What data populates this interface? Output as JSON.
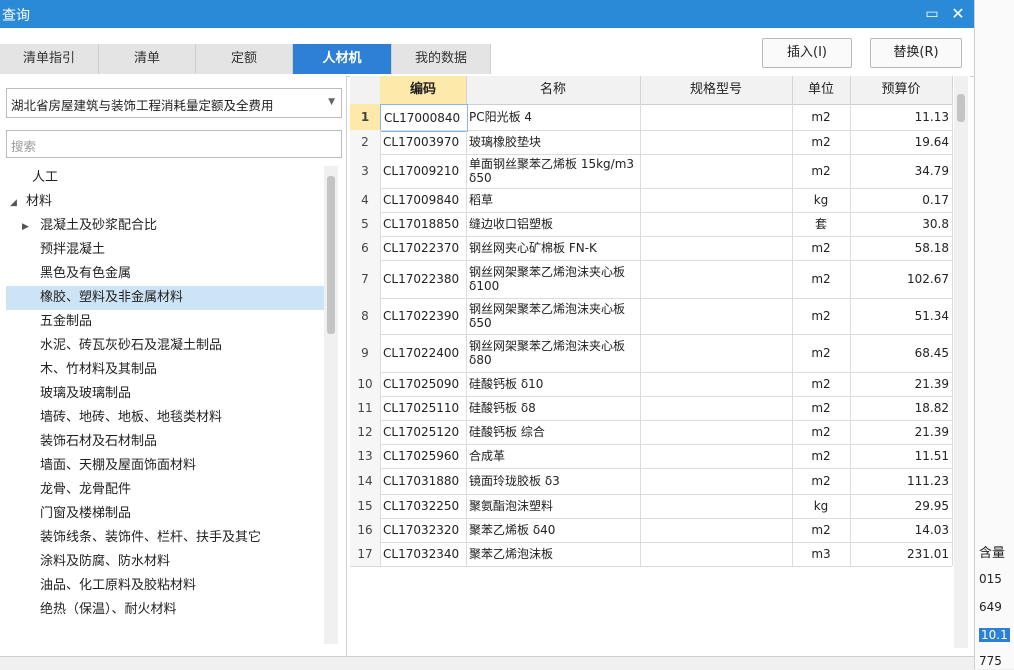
{
  "window": {
    "title": "查询"
  },
  "tabs": [
    {
      "label": "清单指引",
      "active": false
    },
    {
      "label": "清单",
      "active": false
    },
    {
      "label": "定额",
      "active": false
    },
    {
      "label": "人材机",
      "active": true
    },
    {
      "label": "我的数据",
      "active": false
    }
  ],
  "buttons": {
    "insert": "插入(I)",
    "replace": "替换(R)"
  },
  "left": {
    "library": "湖北省房屋建筑与装饰工程消耗量定额及全费用",
    "search_placeholder": "搜索",
    "tree": [
      {
        "label": "人工",
        "level": 0,
        "toggle": "",
        "selected": false
      },
      {
        "label": "材料",
        "level": 0,
        "toggle": "◢",
        "selected": false
      },
      {
        "label": "混凝土及砂浆配合比",
        "level": 1,
        "toggle": "▶",
        "selected": false
      },
      {
        "label": "预拌混凝土",
        "level": 1,
        "toggle": "",
        "selected": false
      },
      {
        "label": "黑色及有色金属",
        "level": 1,
        "toggle": "",
        "selected": false
      },
      {
        "label": "橡胶、塑料及非金属材料",
        "level": 1,
        "toggle": "",
        "selected": true
      },
      {
        "label": "五金制品",
        "level": 1,
        "toggle": "",
        "selected": false
      },
      {
        "label": "水泥、砖瓦灰砂石及混凝土制品",
        "level": 1,
        "toggle": "",
        "selected": false
      },
      {
        "label": "木、竹材料及其制品",
        "level": 1,
        "toggle": "",
        "selected": false
      },
      {
        "label": "玻璃及玻璃制品",
        "level": 1,
        "toggle": "",
        "selected": false
      },
      {
        "label": "墙砖、地砖、地板、地毯类材料",
        "level": 1,
        "toggle": "",
        "selected": false
      },
      {
        "label": "装饰石材及石材制品",
        "level": 1,
        "toggle": "",
        "selected": false
      },
      {
        "label": "墙面、天棚及屋面饰面材料",
        "level": 1,
        "toggle": "",
        "selected": false
      },
      {
        "label": "龙骨、龙骨配件",
        "level": 1,
        "toggle": "",
        "selected": false
      },
      {
        "label": "门窗及楼梯制品",
        "level": 1,
        "toggle": "",
        "selected": false
      },
      {
        "label": "装饰线条、装饰件、栏杆、扶手及其它",
        "level": 1,
        "toggle": "",
        "selected": false
      },
      {
        "label": "涂料及防腐、防水材料",
        "level": 1,
        "toggle": "",
        "selected": false
      },
      {
        "label": "油品、化工原料及胶粘材料",
        "level": 1,
        "toggle": "",
        "selected": false
      },
      {
        "label": "绝热（保温）、耐火材料",
        "level": 1,
        "toggle": "",
        "selected": false
      }
    ]
  },
  "table": {
    "columns": [
      "",
      "编码",
      "名称",
      "规格型号",
      "单位",
      "预算价"
    ],
    "rows": [
      {
        "n": "1",
        "code": "CL17000840",
        "name": "PC阳光板 4",
        "spec": "",
        "unit": "m2",
        "price": "11.13"
      },
      {
        "n": "2",
        "code": "CL17003970",
        "name": "玻璃橡胶垫块",
        "spec": "",
        "unit": "m2",
        "price": "19.64"
      },
      {
        "n": "3",
        "code": "CL17009210",
        "name": "单面钢丝聚苯乙烯板 15kg/m3 δ50",
        "spec": "",
        "unit": "m2",
        "price": "34.79"
      },
      {
        "n": "4",
        "code": "CL17009840",
        "name": "稻草",
        "spec": "",
        "unit": "kg",
        "price": "0.17"
      },
      {
        "n": "5",
        "code": "CL17018850",
        "name": "缝边收口铝塑板",
        "spec": "",
        "unit": "套",
        "price": "30.8"
      },
      {
        "n": "6",
        "code": "CL17022370",
        "name": "钢丝网夹心矿棉板 FN-K",
        "spec": "",
        "unit": "m2",
        "price": "58.18"
      },
      {
        "n": "7",
        "code": "CL17022380",
        "name": "钢丝网架聚苯乙烯泡沫夹心板 δ100",
        "spec": "",
        "unit": "m2",
        "price": "102.67"
      },
      {
        "n": "8",
        "code": "CL17022390",
        "name": "钢丝网架聚苯乙烯泡沫夹心板 δ50",
        "spec": "",
        "unit": "m2",
        "price": "51.34"
      },
      {
        "n": "9",
        "code": "CL17022400",
        "name": "钢丝网架聚苯乙烯泡沫夹心板 δ80",
        "spec": "",
        "unit": "m2",
        "price": "68.45"
      },
      {
        "n": "10",
        "code": "CL17025090",
        "name": "硅酸钙板 δ10",
        "spec": "",
        "unit": "m2",
        "price": "21.39"
      },
      {
        "n": "11",
        "code": "CL17025110",
        "name": "硅酸钙板 δ8",
        "spec": "",
        "unit": "m2",
        "price": "18.82"
      },
      {
        "n": "12",
        "code": "CL17025120",
        "name": "硅酸钙板 综合",
        "spec": "",
        "unit": "m2",
        "price": "21.39"
      },
      {
        "n": "13",
        "code": "CL17025960",
        "name": "合成革",
        "spec": "",
        "unit": "m2",
        "price": "11.51"
      },
      {
        "n": "14",
        "code": "CL17031880",
        "name": "镜面玲珑胶板 δ3",
        "spec": "",
        "unit": "m2",
        "price": "111.23"
      },
      {
        "n": "15",
        "code": "CL17032250",
        "name": "聚氨酯泡沫塑料",
        "spec": "",
        "unit": "kg",
        "price": "29.95"
      },
      {
        "n": "16",
        "code": "CL17032320",
        "name": "聚苯乙烯板 δ40",
        "spec": "",
        "unit": "m2",
        "price": "14.03"
      },
      {
        "n": "17",
        "code": "CL17032340",
        "name": "聚苯乙烯泡沫板",
        "spec": "",
        "unit": "m3",
        "price": "231.01"
      }
    ]
  },
  "side": {
    "header": "含量",
    "values": [
      "015",
      "649",
      "10.1",
      "775"
    ]
  }
}
